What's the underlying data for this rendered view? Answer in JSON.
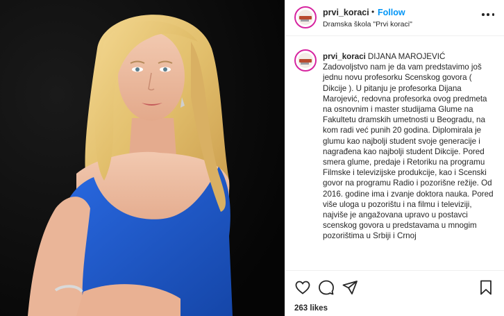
{
  "post": {
    "username": "prvi_koraci",
    "follow_dot": "•",
    "follow_label": "Follow",
    "account_subtitle": "Dramska škola \"Prvi koraci\"",
    "caption_username": "prvi_koraci",
    "caption_title": "DIJANA MAROJEVIĆ",
    "caption_text": "Zadovoljstvo nam je da vam predstavimo još jednu novu profesorku Scenskog govora ( Dikcije ). U pitanju je profesorka Dijana Marojević, redovna profesorka ovog predmeta na osnovnim i master studijama Glume na Fakultetu dramskih umetnosti u Beogradu, na kom radi već punih 20 godina. Diplomirala je glumu kao najbolji student svoje generacije i nagrađena kao najbolji student Dikcije. Pored smera glume, predaje i Retoriku na programu Filmske i televizijske produkcije, kao i Scenski govor na programu Radio i pozorišne režije. Od 2016. godine ima i zvanje doktora nauka. Pored više uloga u pozorištu i na filmu i televiziji, najviše je angažovana upravo u postavci scenskog govora u predstavama u mnogim pozorištima u Srbiji i Crnoj",
    "likes": "263 likes"
  },
  "icons": {
    "more": "more-options-icon",
    "like": "heart-icon",
    "comment": "comment-icon",
    "share": "paper-plane-icon",
    "save": "bookmark-icon"
  },
  "colors": {
    "follow": "#0095f6",
    "text": "#262626",
    "avatar_ring": "#d6249f",
    "photo_background": "#0b0b0b",
    "dress": "#1f5bd0"
  }
}
